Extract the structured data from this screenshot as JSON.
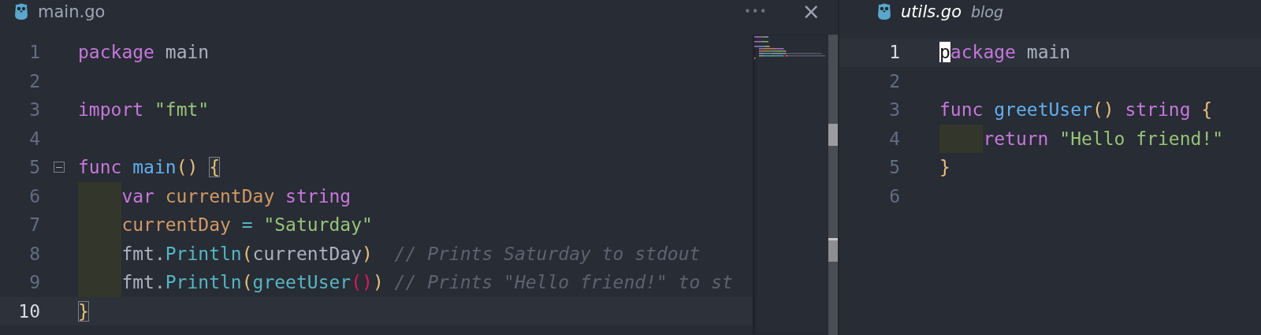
{
  "panes": [
    {
      "tab": {
        "title": "main.go",
        "italic": false
      },
      "more": "•••",
      "close": "×",
      "minimap": true,
      "lines": [
        {
          "number": "1",
          "current": false,
          "indented": false,
          "fold_marker": false,
          "tokens": [
            {
              "kind": "keyword",
              "text": "package"
            },
            {
              "kind": "plain",
              "text": " main"
            }
          ]
        },
        {
          "number": "2",
          "current": false,
          "fold_marker": false
        },
        {
          "number": "3",
          "current": false,
          "indented": false,
          "fold_marker": false,
          "tokens": [
            {
              "kind": "keyword",
              "text": "import"
            },
            {
              "kind": "string",
              "text": " \"fmt\""
            }
          ]
        },
        {
          "number": "4",
          "current": false,
          "fold_marker": false
        },
        {
          "number": "5",
          "current": false,
          "indented": false,
          "fold_marker": true,
          "tokens": [
            {
              "kind": "keyword",
              "text": "func"
            },
            {
              "kind": "function",
              "text": " main"
            },
            {
              "kind": "paren",
              "text": "() "
            },
            {
              "kind": "matched-bracket",
              "text": "{"
            }
          ]
        },
        {
          "number": "6",
          "current": false,
          "indented": true,
          "fold_marker": false,
          "tokens": [
            {
              "kind": "keyword",
              "text": "var"
            },
            {
              "kind": "variable",
              "text": " currentDay"
            },
            {
              "kind": "keyword",
              "text": " string"
            }
          ]
        },
        {
          "number": "7",
          "current": false,
          "indented": true,
          "fold_marker": false,
          "tokens": [
            {
              "kind": "variable",
              "text": "currentDay"
            },
            {
              "kind": "operator",
              "text": " ="
            },
            {
              "kind": "string",
              "text": " \"Saturday\""
            }
          ]
        },
        {
          "number": "8",
          "current": false,
          "indented": true,
          "fold_marker": false,
          "tokens": [
            {
              "kind": "plain",
              "text": "fmt."
            },
            {
              "kind": "method",
              "text": "Println"
            },
            {
              "kind": "paren",
              "text": "("
            },
            {
              "kind": "plain",
              "text": "currentDay"
            },
            {
              "kind": "paren",
              "text": ")"
            },
            {
              "kind": "comment",
              "text": "  // Prints Saturday to stdout"
            }
          ]
        },
        {
          "number": "9",
          "current": false,
          "indented": true,
          "fold_marker": false,
          "tokens": [
            {
              "kind": "plain",
              "text": "fmt."
            },
            {
              "kind": "method",
              "text": "Println"
            },
            {
              "kind": "paren",
              "text": "("
            },
            {
              "kind": "method",
              "text": "greetUser"
            },
            {
              "kind": "inner-paren",
              "text": "()"
            },
            {
              "kind": "paren",
              "text": ")"
            },
            {
              "kind": "comment",
              "text": " // Prints \"Hello friend!\" to st"
            }
          ]
        },
        {
          "number": "10",
          "current": true,
          "indented": false,
          "fold_marker": false,
          "tokens": [
            {
              "kind": "matched-bracket",
              "text": "}"
            }
          ]
        }
      ]
    },
    {
      "tab": {
        "title": "utils.go",
        "italic": true,
        "note": "blog"
      },
      "minimap": false,
      "lines": [
        {
          "number": "1",
          "current": true,
          "indented": false,
          "fold_marker": false,
          "tokens": [
            {
              "kind": "cursor",
              "text": "p"
            },
            {
              "kind": "keyword",
              "text": "ackage"
            },
            {
              "kind": "plain",
              "text": " main"
            }
          ]
        },
        {
          "number": "2",
          "current": false,
          "indented": false,
          "fold_marker": false
        },
        {
          "number": "3",
          "current": false,
          "indented": false,
          "fold_marker": false,
          "tokens": [
            {
              "kind": "keyword",
              "text": "func"
            },
            {
              "kind": "function",
              "text": " greetUser"
            },
            {
              "kind": "paren",
              "text": "()"
            },
            {
              "kind": "keyword",
              "text": " string"
            },
            {
              "kind": "brace",
              "text": " {"
            }
          ]
        },
        {
          "number": "4",
          "current": false,
          "indented": true,
          "fold_marker": false,
          "tokens": [
            {
              "kind": "keyword",
              "text": "return"
            },
            {
              "kind": "string",
              "text": " \"Hello friend!\""
            }
          ]
        },
        {
          "number": "5",
          "current": false,
          "indented": false,
          "fold_marker": false,
          "tokens": [
            {
              "kind": "brace",
              "text": "}"
            }
          ]
        },
        {
          "number": "6",
          "current": false,
          "fold_marker": false
        }
      ]
    }
  ]
}
